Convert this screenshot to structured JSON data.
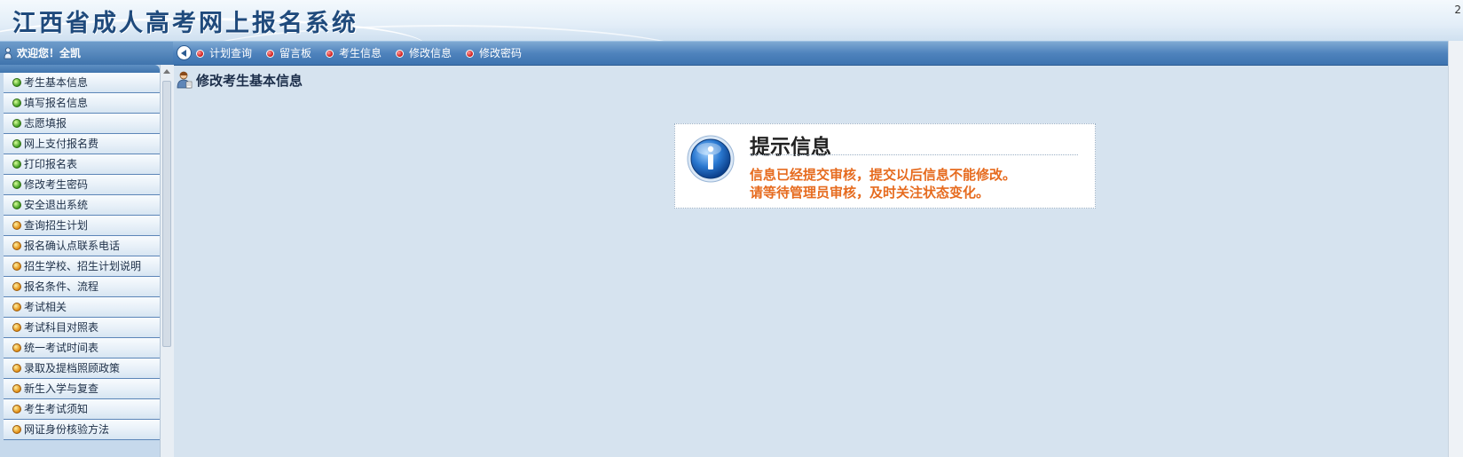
{
  "header": {
    "title": "江西省成人高考网上报名系统",
    "corner_mark": "2"
  },
  "topbar": {
    "welcome": "欢迎您！全凯",
    "nav": [
      {
        "label": "计划查询",
        "icon": "red-dot-icon"
      },
      {
        "label": "留言板",
        "icon": "red-dot-icon"
      },
      {
        "label": "考生信息",
        "icon": "red-dot-icon"
      },
      {
        "label": "修改信息",
        "icon": "red-dot-icon"
      },
      {
        "label": "修改密码",
        "icon": "red-dot-icon"
      }
    ]
  },
  "sidebar": {
    "items": [
      {
        "label": "考生基本信息",
        "bullet": "green"
      },
      {
        "label": "填写报名信息",
        "bullet": "green"
      },
      {
        "label": "志愿填报",
        "bullet": "green"
      },
      {
        "label": "网上支付报名费",
        "bullet": "green"
      },
      {
        "label": "打印报名表",
        "bullet": "green"
      },
      {
        "label": "修改考生密码",
        "bullet": "green"
      },
      {
        "label": "安全退出系统",
        "bullet": "green"
      },
      {
        "label": "查询招生计划",
        "bullet": "orange"
      },
      {
        "label": "报名确认点联系电话",
        "bullet": "orange"
      },
      {
        "label": "招生学校、招生计划说明",
        "bullet": "orange"
      },
      {
        "label": "报名条件、流程",
        "bullet": "orange"
      },
      {
        "label": "考试相关",
        "bullet": "orange"
      },
      {
        "label": "考试科目对照表",
        "bullet": "orange"
      },
      {
        "label": "统一考试时间表",
        "bullet": "orange"
      },
      {
        "label": "录取及提档照顾政策",
        "bullet": "orange"
      },
      {
        "label": "新生入学与复查",
        "bullet": "orange"
      },
      {
        "label": "考生考试须知",
        "bullet": "orange"
      },
      {
        "label": "网证身份核验方法",
        "bullet": "orange"
      }
    ]
  },
  "main": {
    "heading": "修改考生基本信息",
    "info_box": {
      "title": "提示信息",
      "line1": "信息已经提交审核，提交以后信息不能修改。",
      "line2": "请等待管理员审核，及时关注状态变化。",
      "icon": "info-icon"
    }
  },
  "colors": {
    "accent_blue": "#3d73af",
    "message_orange": "#e66b1f",
    "background": "#d6e3ef"
  }
}
